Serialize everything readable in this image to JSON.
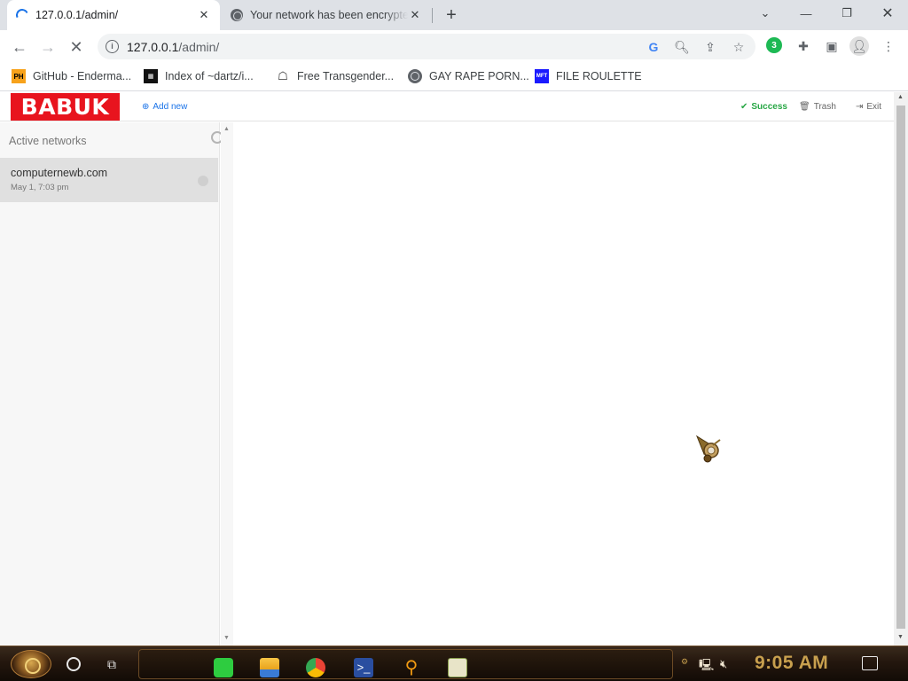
{
  "browser": {
    "tabs": [
      {
        "title": "127.0.0.1/admin/",
        "active": true
      },
      {
        "title": "Your network has been encrypted",
        "active": false
      }
    ],
    "new_tab_icon": "plus-icon",
    "url": {
      "host": "127.0.0.1",
      "path": "/admin/"
    },
    "bookmarks": [
      {
        "label": "GitHub - Enderma...",
        "icon": "PH"
      },
      {
        "label": "Index of ~dartz/i...",
        "icon": "grid"
      },
      {
        "label": "Free Transgender...",
        "icon": "robot"
      },
      {
        "label": "GAY RAPE PORN...",
        "icon": "globe"
      },
      {
        "label": "FILE ROULETTE",
        "icon": "MFT"
      }
    ],
    "extension_badge": "3"
  },
  "app": {
    "logo": "BABUK",
    "add_new": "Add new",
    "status": "Success",
    "trash": "Trash",
    "exit": "Exit",
    "status_color": "#28a745",
    "link_color": "#1a73e8",
    "brand_color": "#e8141e"
  },
  "sidebar": {
    "search_label": "Active networks",
    "networks": [
      {
        "name": "computernewb.com",
        "date": "May 1, 7:03 pm"
      }
    ]
  },
  "taskbar": {
    "clock": "9:05 AM"
  }
}
